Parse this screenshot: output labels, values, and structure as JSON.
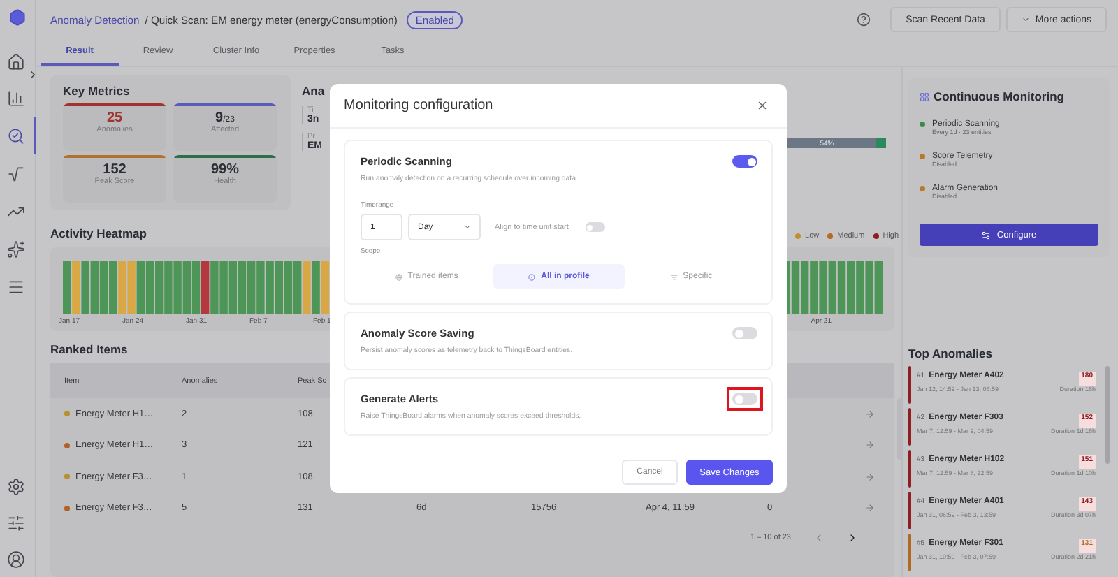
{
  "app": {
    "breadcrumb_link": "Anomaly Detection",
    "breadcrumb_rest": "/ Quick Scan: EM energy meter (energyConsumption)",
    "status": "Enabled",
    "buttons": [
      "Scan Recent Data",
      "More actions"
    ]
  },
  "sidebar": {
    "items": [
      {
        "kind": "home",
        "selected": false
      },
      {
        "kind": "chart",
        "selected": false
      },
      {
        "kind": "search",
        "selected": true
      },
      {
        "kind": "formula",
        "selected": false
      },
      {
        "kind": "trend",
        "selected": false
      },
      {
        "kind": "sparkle",
        "selected": false
      },
      {
        "kind": "menu",
        "selected": false
      }
    ],
    "bottom": [
      {
        "kind": "settings"
      },
      {
        "kind": "sliders"
      },
      {
        "kind": "user"
      }
    ]
  },
  "tabs": [
    {
      "label": "Result",
      "selected": true
    },
    {
      "label": "Review",
      "selected": false
    },
    {
      "label": "Cluster Info",
      "selected": false
    },
    {
      "label": "Properties",
      "selected": false
    },
    {
      "label": "Tasks",
      "selected": false
    }
  ],
  "key_metrics": {
    "title": "Key Metrics",
    "items": [
      {
        "value": "25",
        "label": "Anomalies",
        "color": "#a0342e",
        "emphasis": true
      },
      {
        "value": "9$_{/23}$",
        "label": "Affected",
        "color": "#5a5ab8",
        "emphasis": false
      },
      {
        "value": "152",
        "label": "Peak Score",
        "color": "#b0722f",
        "emphasis": false
      },
      {
        "value": "99%",
        "label": "Health",
        "color": "#2f6e4a",
        "emphasis": false
      }
    ]
  },
  "analysis": {
    "title": "Ana",
    "fields": [
      {
        "label": "Ti",
        "value": "3n"
      },
      {
        "label": "Pr",
        "value": "EM"
      }
    ],
    "bar_label": "54%",
    "level": 0.98
  },
  "heatmap": {
    "title": "Activity Heatmap",
    "legend": [
      {
        "label": "Low",
        "color": "#c09030"
      },
      {
        "label": "Medium",
        "color": "#b56a28"
      },
      {
        "label": "High",
        "color": "#8f1d22"
      }
    ],
    "axis_labels": [
      "Jan 17",
      "Jan 24",
      "Jan 31",
      "Feb 7",
      "Feb 1"
    ],
    "end_label": "Apr 21"
  },
  "ranked": {
    "title": "Ranked Items",
    "columns": [
      "Item",
      "Anomalies",
      "Peak Sc"
    ],
    "rows": [
      {
        "item": "Energy Meter H1…",
        "color": "#b89030",
        "anomalies": "2",
        "peak_score": "108"
      },
      {
        "item": "Energy Meter H1…",
        "color": "#b06028",
        "anomalies": "3",
        "peak_score": "121"
      },
      {
        "item": "Energy Meter F3…",
        "color": "#b89030",
        "anomalies": "1",
        "peak_score": "108"
      },
      {
        "item": "Energy Meter F3…",
        "color": "#b06028",
        "anomalies": "5",
        "peak_score": "131",
        "column_4": "6d",
        "column_5": "15756",
        "column_6": "Apr 4, 11:59",
        "column_7": "0"
      }
    ],
    "pager": {
      "label": "1 – 10 of 23",
      "prev_disabled": true
    }
  },
  "monitoring": {
    "title": "Continuous Monitoring",
    "items": [
      {
        "title": "Periodic Scanning",
        "detail": "Every 1d · 23 entities",
        "color": "#3a8a4a"
      },
      {
        "title": "Score Telemetry",
        "detail": "Disabled",
        "color": "#b87a2a"
      },
      {
        "title": "Alarm Generation",
        "detail": "Disabled",
        "color": "#b87a2a"
      }
    ],
    "button": "Configure"
  },
  "top_anomalies": {
    "title": "Top Anomalies",
    "items": [
      {
        "rank": "#1",
        "name": "Energy Meter A402",
        "range": "Jan 12, 14:59 - Jan 13, 06:59",
        "score": "180",
        "duration": "Duration 16h",
        "color": "#8f1d22"
      },
      {
        "rank": "#2",
        "name": "Energy Meter F303",
        "range": "Mar 7, 12:59 - Mar 9, 04:59",
        "score": "152",
        "duration": "Duration 1d 16h",
        "color": "#8f1d22"
      },
      {
        "rank": "#3",
        "name": "Energy Meter H102",
        "range": "Mar 7, 12:59 - Mar 8, 22:59",
        "score": "151",
        "duration": "Duration 1d 10h",
        "color": "#8f1d22"
      },
      {
        "rank": "#4",
        "name": "Energy Meter A401",
        "range": "Jan 31, 06:59 - Feb 3, 13:59",
        "score": "143",
        "duration": "Duration 3d 07h",
        "color": "#8f1d22"
      },
      {
        "rank": "#5",
        "name": "Energy Meter F301",
        "range": "Jan 31, 10:59 - Feb 3, 07:59",
        "score": "131",
        "duration": "Duration 2d 21h",
        "color": "#b06a22"
      }
    ]
  },
  "modal": {
    "title": "Monitoring configuration",
    "sections": [
      {
        "kind": "scanning",
        "title": "Periodic Scanning",
        "description": "Run anomaly detection on a recurring schedule over incoming data.",
        "on": true,
        "highlighted": false,
        "timerange_label": "Timerange",
        "amount": "1",
        "unit": "Day",
        "align_label": "Align to time unit start",
        "align_on": false,
        "scope_label": "Scope",
        "scope_options": [
          {
            "label": "Trained items",
            "selected": false
          },
          {
            "label": "All in profile",
            "selected": true
          },
          {
            "label": "Specific",
            "selected": false
          }
        ]
      },
      {
        "kind": "toggle",
        "title": "Anomaly Score Saving",
        "description": "Persist anomaly scores as telemetry back to ThingsBoard entities.",
        "on": false,
        "highlighted": false
      },
      {
        "kind": "toggle",
        "title": "Generate Alerts",
        "description": "Raise ThingsBoard alarms when anomaly scores exceed thresholds.",
        "on": false,
        "highlighted": true
      }
    ],
    "cancel": "Cancel",
    "save": "Save Changes"
  }
}
